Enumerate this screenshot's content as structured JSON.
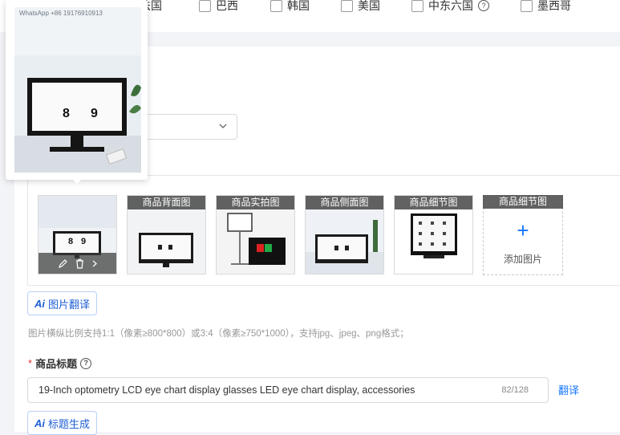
{
  "countries": [
    {
      "label": "法国"
    },
    {
      "label": "巴西"
    },
    {
      "label": "韩国"
    },
    {
      "label": "美国"
    },
    {
      "label": "中东六国",
      "help": "?"
    },
    {
      "label": "墨西哥"
    }
  ],
  "images": {
    "thumbnails": [
      {
        "label": ""
      },
      {
        "label": "商品背面图"
      },
      {
        "label": "商品实拍图"
      },
      {
        "label": "商品侧面图"
      },
      {
        "label": "商品细节图"
      }
    ],
    "add_slot": {
      "label": "商品细节图",
      "plus": "+",
      "text": "添加图片"
    },
    "preview_watermark": "WhatsApp +86 19176910913",
    "preview_digits": [
      "8",
      "9"
    ]
  },
  "buttons": {
    "ai_glyph": "Ai",
    "image_translate": "图片翻译",
    "title_generate": "标题生成"
  },
  "hint": "图片横纵比例支持1:1（像素≥800*800）或3:4（像素≥750*1000），支持jpg、jpeg、png格式；",
  "title_field": {
    "required_mark": "*",
    "label": "商品标题",
    "help": "?",
    "value": "19-Inch optometry LCD eye chart display glasses LED eye chart display, accessories",
    "counter": "82/128",
    "translate": "翻译"
  },
  "colors": {
    "accent": "#1677ff",
    "required": "#e53935"
  }
}
